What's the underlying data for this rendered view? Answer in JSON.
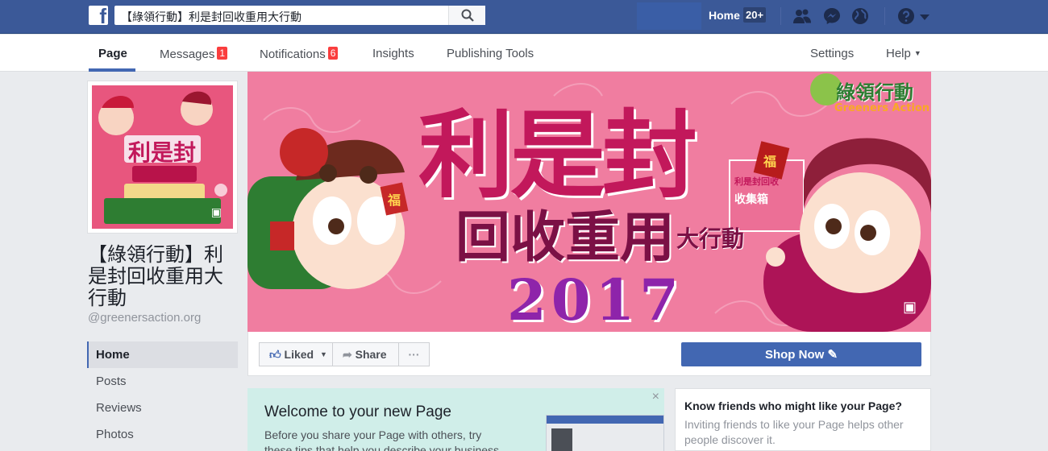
{
  "topbar": {
    "search_value": "【綠領行動】利是封回收重用大行動",
    "home_label": "Home",
    "home_count": "20+"
  },
  "tabs": [
    {
      "label": "Page"
    },
    {
      "label": "Messages",
      "badge": "1"
    },
    {
      "label": "Notifications",
      "badge": "6"
    },
    {
      "label": "Insights"
    },
    {
      "label": "Publishing Tools"
    }
  ],
  "right_tabs": {
    "settings": "Settings",
    "help": "Help"
  },
  "page": {
    "name": "【綠領行動】利是封回收重用大行動",
    "handle": "@greenersaction.org"
  },
  "sidebar": [
    {
      "label": "Home"
    },
    {
      "label": "Posts"
    },
    {
      "label": "Reviews"
    },
    {
      "label": "Photos"
    }
  ],
  "cover": {
    "title": "利是封",
    "subtitle": "回收重用",
    "subtitle_small": "大行動",
    "year": "2017",
    "logo_text": "綠領行動",
    "logo_sub": "Greeners Action",
    "box_label": "收集箱",
    "box_sub": "利是封回收",
    "fu_char": "福"
  },
  "actions": {
    "liked": "Liked",
    "share": "Share",
    "more": "···",
    "shop_now": "Shop Now"
  },
  "welcome": {
    "title": "Welcome to your new Page",
    "text": "Before you share your Page with others, try these tips that help you describe your business, brand or",
    "close": "×"
  },
  "know_friends": {
    "title": "Know friends who might like your Page?",
    "text": "Inviting friends to like your Page helps other people discover it."
  },
  "colors": {
    "fb_blue": "#3b5998",
    "accent": "#4267b2",
    "badge_red": "#fa3e3e",
    "cover_pink": "#f07da0",
    "welcome_bg": "#d0eee9"
  }
}
